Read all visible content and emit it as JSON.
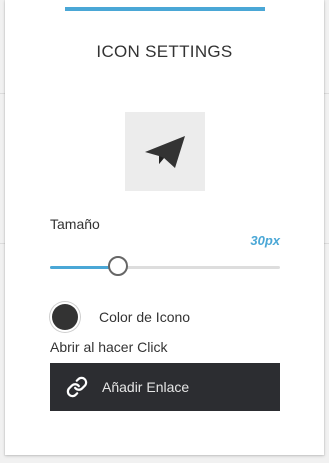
{
  "colors": {
    "accent": "#4aa7d6",
    "icon_color": "#333333",
    "button_background": "#2c2d31"
  },
  "panel": {
    "title": "ICON SETTINGS",
    "preview": {
      "icon": "paper-plane-icon"
    },
    "size": {
      "label": "Tamaño",
      "value_text": "30px",
      "slider_fraction": 0.3
    },
    "color": {
      "label": "Color de Icono"
    },
    "link": {
      "label": "Abrir al hacer Click",
      "button_label": "Añadir Enlace",
      "button_icon": "link-icon"
    }
  }
}
